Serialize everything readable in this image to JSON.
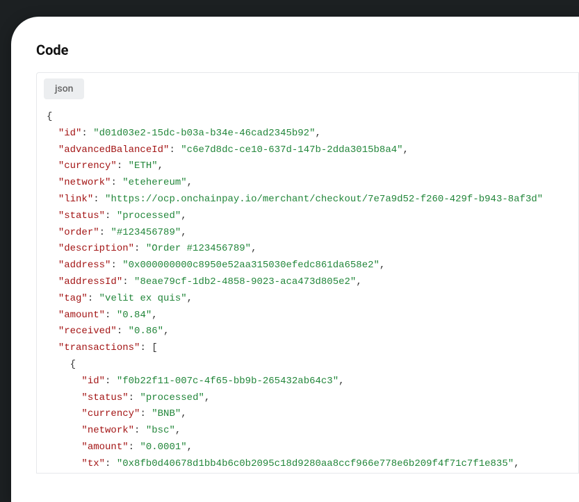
{
  "heading": "Code",
  "langTab": "json",
  "code": {
    "root": {
      "id": "d01d03e2-15dc-b03a-b34e-46cad2345b92",
      "advancedBalanceId": "c6e7d8dc-ce10-637d-147b-2dda3015b8a4",
      "currency": "ETH",
      "network": "etehereum",
      "link": "https://ocp.onchainpay.io/merchant/checkout/7e7a9d52-f260-429f-b943-8af3d",
      "status": "processed",
      "order": "#123456789",
      "description": "Order #123456789",
      "address": "0x000000000c8950e52aa315030efedc861da658e2",
      "addressId": "8eae79cf-1db2-4858-9023-aca473d805e2",
      "tag": "velit ex quis",
      "amount": "0.84",
      "received": "0.86"
    },
    "tx0": {
      "id": "f0b22f11-007c-4f65-bb9b-265432ab64c3",
      "status": "processed",
      "currency": "BNB",
      "network": "bsc",
      "amount": "0.0001",
      "tx": "0x8fb0d40678d1bb4b6c0b2095c18d9280aa8ccf966e778e6b209f4f71c7f1e835"
    },
    "keyLabels": {
      "id": "\"id\"",
      "advancedBalanceId": "\"advancedBalanceId\"",
      "currency": "\"currency\"",
      "network": "\"network\"",
      "link": "\"link\"",
      "status": "\"status\"",
      "order": "\"order\"",
      "description": "\"description\"",
      "address": "\"address\"",
      "addressId": "\"addressId\"",
      "tag": "\"tag\"",
      "amount": "\"amount\"",
      "received": "\"received\"",
      "transactions": "\"transactions\"",
      "tx": "\"tx\""
    }
  }
}
